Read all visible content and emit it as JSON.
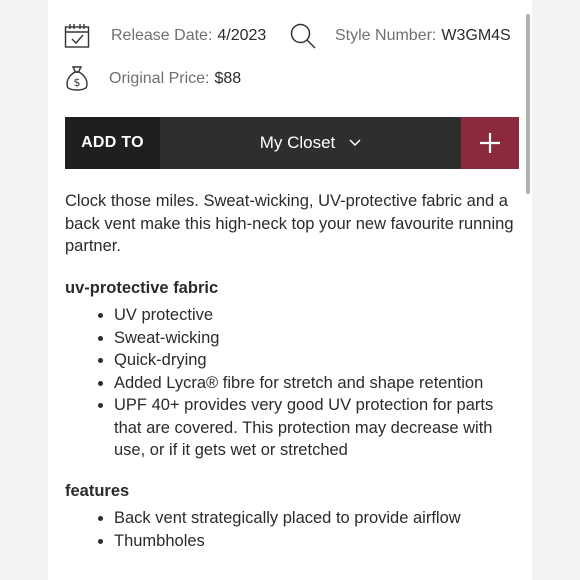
{
  "product": {
    "release_date_label": "Release Date:",
    "release_date_value": "4/2023",
    "style_number_label": "Style Number:",
    "style_number_value": "W3GM4S",
    "original_price_label": "Original Price:",
    "original_price_value": "$88"
  },
  "icons": {
    "calendar": "calendar-check-icon",
    "search": "search-icon",
    "money": "money-bag-icon",
    "chevron": "chevron-down-icon",
    "plus": "plus-icon"
  },
  "add_bar": {
    "add_to_label": "ADD TO",
    "closet_selected": "My Closet",
    "accent_color": "#8b2a3d"
  },
  "description": "Clock those miles. Sweat-wicking, UV-protective fabric and a back vent make this high-neck top your new favourite running partner.",
  "sections": [
    {
      "title": "uv-protective fabric",
      "items": [
        "UV protective",
        "Sweat-wicking",
        "Quick-drying",
        "Added Lycra® fibre for stretch and shape retention",
        "UPF 40+ provides very good UV protection for parts that are covered. This protection may decrease with use, or if it gets wet or stretched"
      ]
    },
    {
      "title": "features",
      "items": [
        "Back vent strategically placed to provide airflow",
        "Thumbholes"
      ]
    }
  ]
}
